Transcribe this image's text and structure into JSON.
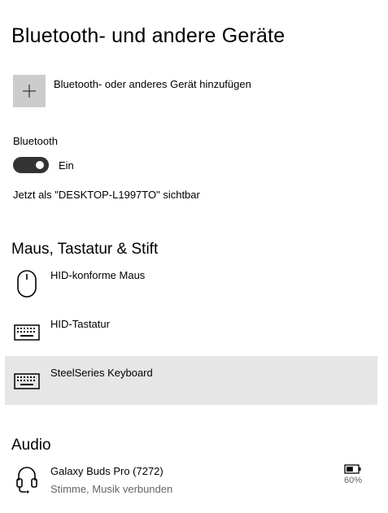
{
  "page": {
    "title": "Bluetooth- und andere Geräte"
  },
  "add_device": {
    "icon": "plus-icon",
    "label": "Bluetooth- oder anderes Gerät hinzufügen"
  },
  "bluetooth": {
    "label": "Bluetooth",
    "toggle_state": "Ein",
    "toggle_on": true,
    "visibility_text": "Jetzt als \"DESKTOP-L1997TO\" sichtbar"
  },
  "sections": {
    "input_devices": {
      "title": "Maus, Tastatur & Stift",
      "devices": [
        {
          "icon": "mouse-icon",
          "name": "HID-konforme Maus"
        },
        {
          "icon": "keyboard-icon",
          "name": "HID-Tastatur"
        },
        {
          "icon": "keyboard-icon",
          "name": "SteelSeries Keyboard",
          "selected": true
        }
      ]
    },
    "audio": {
      "title": "Audio",
      "devices": [
        {
          "icon": "headset-icon",
          "name": "Galaxy Buds Pro (7272)",
          "status": "Stimme, Musik verbunden",
          "battery": "60%",
          "battery_level": 0.6
        }
      ]
    }
  },
  "colors": {
    "toggle_on": "#333333",
    "selected_row": "#e6e6e6",
    "add_button_bg": "#cccccc",
    "secondary_text": "#666666"
  }
}
